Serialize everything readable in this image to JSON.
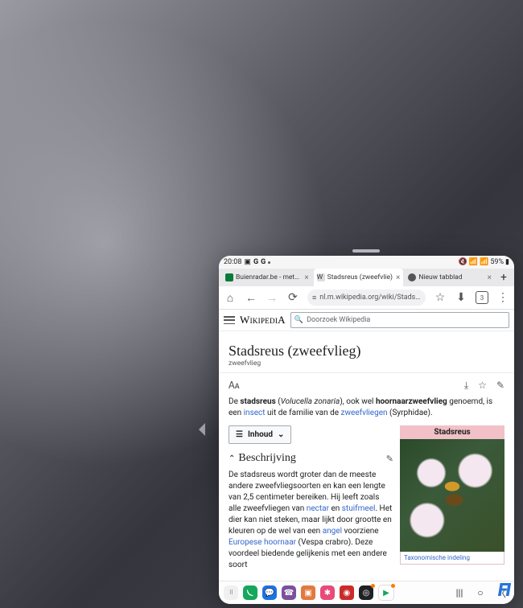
{
  "status": {
    "time": "20:08",
    "battery": "59%",
    "indicators_left": [
      "G",
      "G"
    ],
    "indicators_right": [
      "📶",
      "📶"
    ]
  },
  "tabs": [
    {
      "label": "Buienradar.be - meteo",
      "active": false,
      "favicon_color": "#0a7a3a"
    },
    {
      "label": "Stadsreus (zweefvlie)",
      "active": true,
      "favicon_color": "#ffffff"
    },
    {
      "label": "Nieuw tabblad",
      "active": false,
      "favicon_color": "#555555"
    }
  ],
  "toolbar": {
    "url": "nl.m.wikipedia.org/wiki/Stadsreus_(zv",
    "tab_count": "3"
  },
  "wiki": {
    "brand": "WikipediA",
    "search_placeholder": "Doorzoek Wikipedia",
    "title": "Stadsreus (zweefvlieg)",
    "subtitle": "zweefvlieg",
    "lead_html": "De <b>stadsreus</b> (<i>Volucella zonaria</i>), ook wel <b>hoornaarzweefvlieg</b> genoemd, is een <a>insect</a> uit de familie van de <a>zweefvliegen</a> (Syrphidae).",
    "toc_label": "Inhoud",
    "section_title": "Beschrijving",
    "section_body": "De stadsreus wordt groter dan de meeste andere zweefvliegsoorten en kan een lengte van 2,5 centimeter bereiken. Hij leeft zoals alle zweefvliegen van <a>nectar</a> en <a>stuifmeel</a>. Het dier kan niet steken, maar lijkt door grootte en kleuren op de wel van een <a>angel</a> voorziene <a>Europese hoornaar</a> (Vespa crabro). Deze voordeel biedende gelijkenis met een andere soort",
    "infobox_title": "Stadsreus",
    "infobox_caption": "Taxonomische indeling"
  },
  "apps": [
    {
      "name": "drawer",
      "color": "#f5f5f5",
      "glyph": "⋮⋮⋮",
      "text_color": "#555"
    },
    {
      "name": "phone",
      "color": "#16a75c",
      "glyph": "C"
    },
    {
      "name": "messages",
      "color": "#1a73e8",
      "glyph": "●"
    },
    {
      "name": "viber",
      "color": "#7b519c",
      "glyph": "V"
    },
    {
      "name": "app-orange",
      "color": "#e27a3f",
      "glyph": "■"
    },
    {
      "name": "app-pink",
      "color": "#e84a7a",
      "glyph": "✱"
    },
    {
      "name": "app-red",
      "color": "#cc2b2b",
      "glyph": "○"
    },
    {
      "name": "camera",
      "color": "#202124",
      "glyph": "◎",
      "notif": true
    },
    {
      "name": "play",
      "color": "#ffffff",
      "glyph": "▶",
      "text_color": "#1aa260",
      "notif": true
    }
  ],
  "watermark": "FI"
}
